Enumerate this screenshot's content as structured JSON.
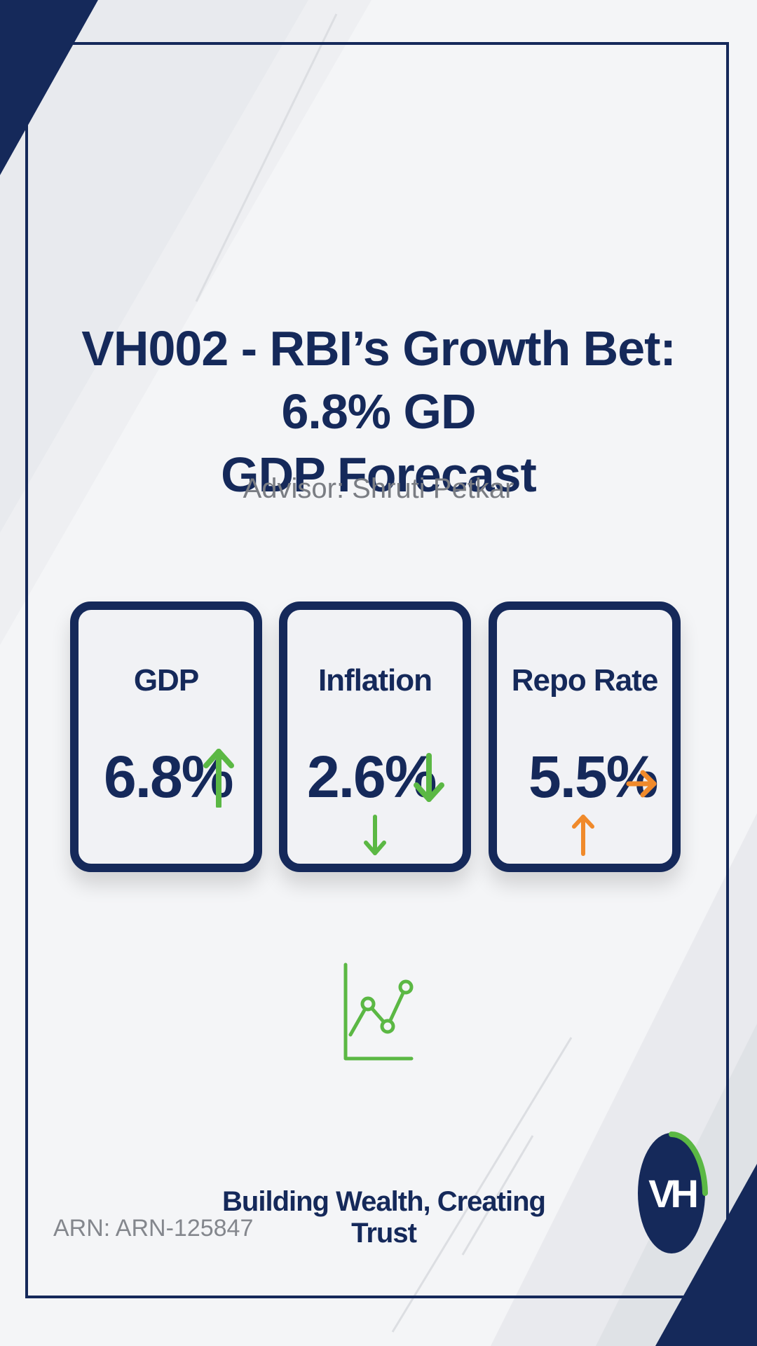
{
  "header": {
    "title_line1": "VH002 - RBI’s Growth Bet: 6.8% GD",
    "title_line2": "GDP Forecast",
    "advisor": "Advisor: Shruti Petkar"
  },
  "cards": [
    {
      "label": "GDP",
      "value": "6.8%",
      "trend": "up",
      "arrow_icon": "arrow-up-icon",
      "color": "#5bb844"
    },
    {
      "label": "Inflation",
      "value": "2.6%",
      "trend": "down",
      "arrow_icon": "arrow-down-icon",
      "color": "#5bb844"
    },
    {
      "label": "Repo Rate",
      "value": "5.5%",
      "trend": "right",
      "arrow_icon": "arrow-right-icon",
      "color": "#f08a2b"
    }
  ],
  "footer": {
    "tagline": "Building Wealth, Creating Trust",
    "arn": "ARN: ARN-125847"
  },
  "logo": {
    "text": "VH",
    "icon": "vh-logo-icon"
  },
  "colors": {
    "navy": "#15295a",
    "green": "#5bb844",
    "orange": "#f08a2b",
    "grey_text": "#7a7d83",
    "background": "#f4f5f7"
  }
}
